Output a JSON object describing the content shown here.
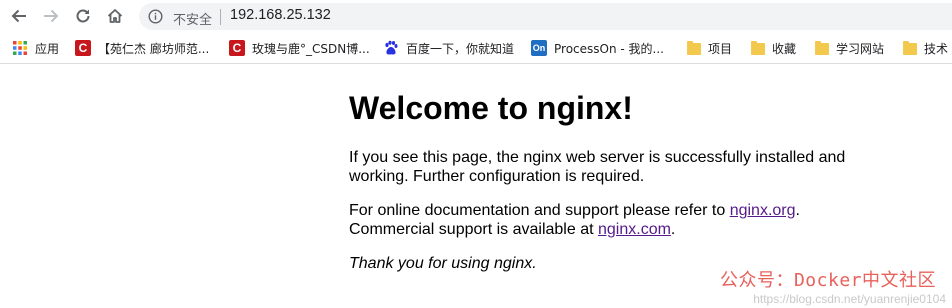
{
  "toolbar": {
    "back_icon": "back-arrow-icon",
    "forward_icon": "forward-arrow-icon",
    "reload_icon": "reload-icon",
    "home_icon": "home-icon",
    "security_label": "不安全",
    "url": "192.168.25.132"
  },
  "bookmarks": {
    "apps_label": "应用",
    "items": [
      {
        "label": "【苑仁杰 廊坊师范...",
        "icon": "csdn-icon"
      },
      {
        "label": "玫瑰与鹿°_CSDN博...",
        "icon": "csdn-icon"
      },
      {
        "label": "百度一下，你就知道",
        "icon": "baidu-paw-icon"
      },
      {
        "label": "ProcessOn - 我的...",
        "icon": "processon-icon"
      },
      {
        "label": "项目",
        "icon": "folder-icon"
      },
      {
        "label": "收藏",
        "icon": "folder-icon"
      },
      {
        "label": "学习网站",
        "icon": "folder-icon"
      },
      {
        "label": "技术",
        "icon": "folder-icon"
      }
    ],
    "csdn_glyph": "C",
    "processon_glyph": "On"
  },
  "page": {
    "heading": "Welcome to nginx!",
    "p1": "If you see this page, the nginx web server is successfully installed and working. Further configuration is required.",
    "p2_prefix": "For online documentation and support please refer to ",
    "link1": "nginx.org",
    "p2_mid": ".",
    "p2_line2": "Commercial support is available at ",
    "link2": "nginx.com",
    "p2_end": ".",
    "thanks": "Thank you for using nginx."
  },
  "watermark": {
    "text": "公众号：Docker中文社区",
    "faint": "https://blog.csdn.net/yuanrenjie0104"
  },
  "colors": {
    "link": "#551a8b",
    "watermark": "#e8615a",
    "omnibox_bg": "#f1f3f4"
  }
}
